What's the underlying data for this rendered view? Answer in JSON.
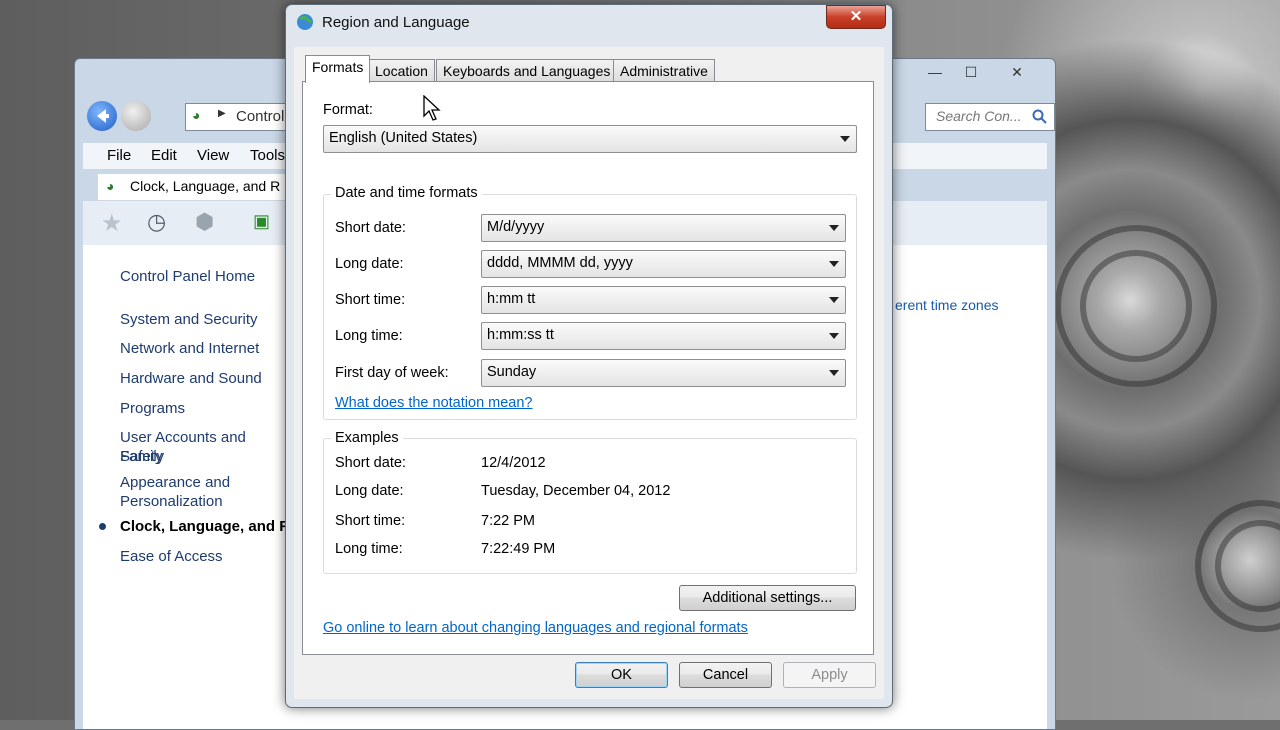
{
  "background_window": {
    "address_text": "Control",
    "search_placeholder": "Search Con...",
    "menu": [
      "File",
      "Edit",
      "View",
      "Tools"
    ],
    "breadcrumb": "Clock, Language, and R",
    "sidebar": {
      "home": "Control Panel Home",
      "items": [
        "System and Security",
        "Network and Internet",
        "Hardware and Sound",
        "Programs",
        "User Accounts and Family",
        "Safety",
        "Appearance and",
        "Personalization",
        "Clock, Language, and R",
        "Ease of Access"
      ]
    },
    "right_link": "erent time zones"
  },
  "dialog": {
    "title": "Region and Language",
    "close_label": "✕",
    "tabs": [
      "Formats",
      "Location",
      "Keyboards and Languages",
      "Administrative"
    ],
    "active_tab": "Formats",
    "format_label": "Format:",
    "format_value": "English (United States)",
    "date_time_group": {
      "title": "Date and time formats",
      "rows": [
        {
          "label": "Short date:",
          "value": "M/d/yyyy"
        },
        {
          "label": "Long date:",
          "value": "dddd, MMMM dd, yyyy"
        },
        {
          "label": "Short time:",
          "value": "h:mm tt"
        },
        {
          "label": "Long time:",
          "value": "h:mm:ss tt"
        },
        {
          "label": "First day of week:",
          "value": "Sunday"
        }
      ],
      "notation_link": "What does the notation mean?"
    },
    "examples_group": {
      "title": "Examples",
      "rows": [
        {
          "label": "Short date:",
          "value": "12/4/2012"
        },
        {
          "label": "Long date:",
          "value": "Tuesday, December 04, 2012"
        },
        {
          "label": "Short time:",
          "value": "7:22 PM"
        },
        {
          "label": "Long time:",
          "value": "7:22:49 PM"
        }
      ]
    },
    "additional_settings": "Additional settings...",
    "online_link": "Go online to learn about changing languages and regional formats",
    "buttons": {
      "ok": "OK",
      "cancel": "Cancel",
      "apply": "Apply"
    }
  }
}
